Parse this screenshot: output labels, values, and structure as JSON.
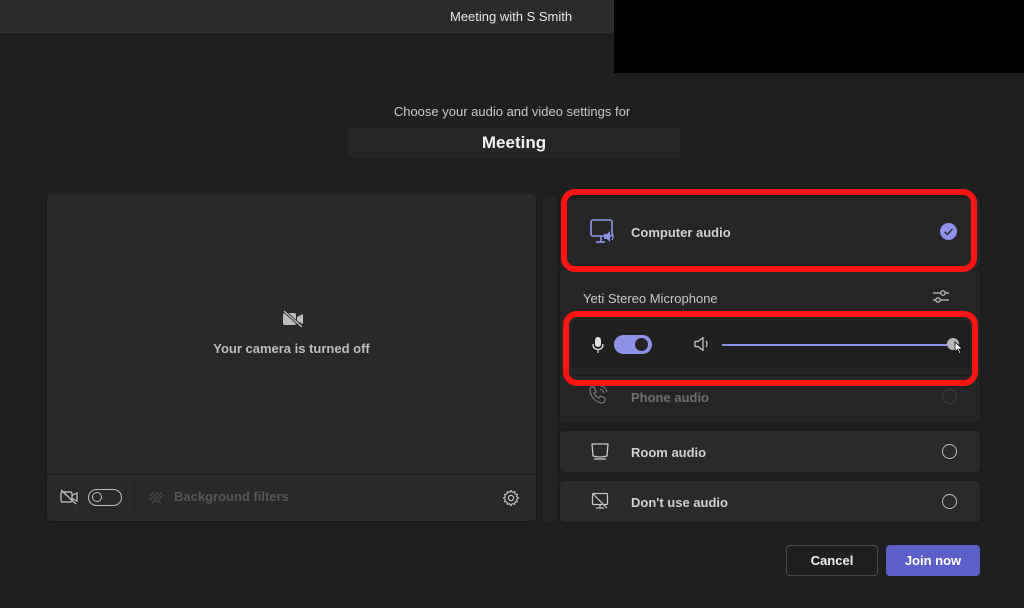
{
  "window": {
    "title": "Meeting with S Smith"
  },
  "header": {
    "subtitle": "Choose your audio and video settings for",
    "meeting_name": "Meeting"
  },
  "video": {
    "camera_status": "Your camera is turned off",
    "camera_toggle_on": false,
    "background_filters_label": "Background filters",
    "icons": {
      "camera_off": "video-off-icon",
      "background_filters": "background-effects-icon",
      "settings": "gear-icon"
    }
  },
  "audio": {
    "options": [
      {
        "id": "computer",
        "label": "Computer audio",
        "icon": "computer-audio-icon",
        "selected": true
      },
      {
        "id": "phone",
        "label": "Phone audio",
        "icon": "phone-audio-icon",
        "selected": false,
        "disabled": true
      },
      {
        "id": "room",
        "label": "Room audio",
        "icon": "room-audio-icon",
        "selected": false
      },
      {
        "id": "none",
        "label": "Don't use audio",
        "icon": "no-audio-icon",
        "selected": false
      }
    ],
    "device": {
      "microphone_name": "Yeti Stereo Microphone",
      "mic_on": true,
      "speaker_volume_percent": 100
    }
  },
  "actions": {
    "cancel_label": "Cancel",
    "join_label": "Join now"
  },
  "colors": {
    "accent": "#8f93e8",
    "primary_button": "#5b5fc7",
    "highlight_annotation": "#ff1414",
    "background": "#1f1f1f"
  }
}
